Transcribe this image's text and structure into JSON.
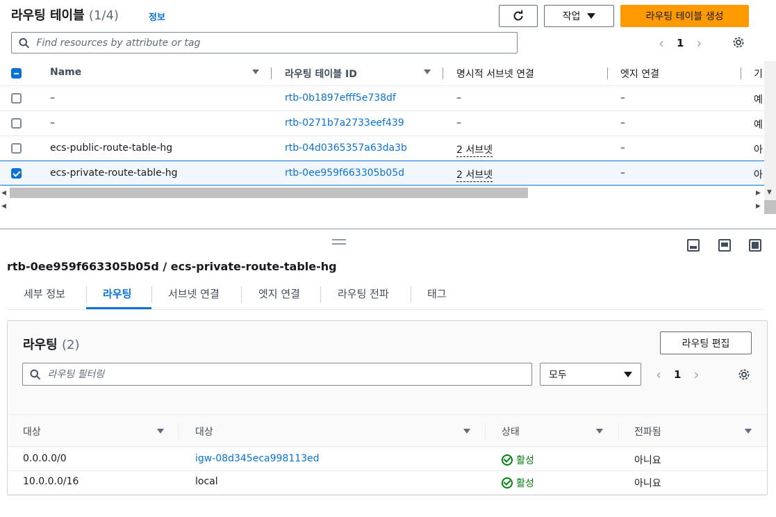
{
  "header": {
    "title": "라우팅 테이블",
    "count": "(1/4)",
    "info_link": "정보",
    "action_button": "작업",
    "create_button": "라우팅 테이블 생성",
    "search_placeholder": "Find resources by attribute or tag",
    "page_number": "1"
  },
  "table": {
    "columns": [
      "Name",
      "라우팅 테이블 ID",
      "명시적 서브넷 연결",
      "엣지 연결",
      "기"
    ],
    "rows": [
      {
        "name": "–",
        "id": "rtb-0b1897efff5e738df",
        "subnet": "–",
        "edge": "–",
        "extra": "예",
        "selected": false
      },
      {
        "name": "–",
        "id": "rtb-0271b7a2733eef439",
        "subnet": "–",
        "edge": "–",
        "extra": "예",
        "selected": false
      },
      {
        "name": "ecs-public-route-table-hg",
        "id": "rtb-04d0365357a63da3b",
        "subnet": "2 서브넷",
        "edge": "–",
        "extra": "아",
        "selected": false
      },
      {
        "name": "ecs-private-route-table-hg",
        "id": "rtb-0ee959f663305b05d",
        "subnet": "2 서브넷",
        "edge": "–",
        "extra": "아",
        "selected": true
      }
    ]
  },
  "detail": {
    "title": "rtb-0ee959f663305b05d / ecs-private-route-table-hg",
    "tabs": [
      "세부 정보",
      "라우팅",
      "서브넷 연결",
      "엣지 연결",
      "라우팅 전파",
      "태그"
    ],
    "active_tab": "라우팅"
  },
  "routes": {
    "title": "라우팅",
    "count": "(2)",
    "edit_button": "라우팅 편집",
    "filter_placeholder": "라우팅 필터링",
    "filter_select": "모두",
    "page_number": "1",
    "columns": [
      "대상",
      "대상",
      "상태",
      "전파됨"
    ],
    "rows": [
      {
        "destination": "0.0.0.0/0",
        "target": "igw-08d345eca998113ed",
        "target_is_link": true,
        "status": "활성",
        "propagated": "아니요"
      },
      {
        "destination": "10.0.0.0/16",
        "target": "local",
        "target_is_link": false,
        "status": "활성",
        "propagated": "아니요"
      }
    ]
  },
  "colors": {
    "accent": "#0972d3",
    "primary_button": "#ff9900",
    "success": "#037f0c"
  }
}
